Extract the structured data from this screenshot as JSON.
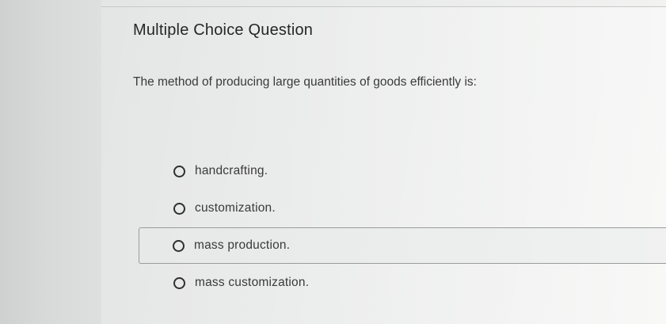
{
  "question": {
    "title": "Multiple Choice Question",
    "prompt": "The method of producing large quantities of goods efficiently is:"
  },
  "options": [
    {
      "label": "handcrafting."
    },
    {
      "label": "customization."
    },
    {
      "label": "mass production.",
      "highlighted": true
    },
    {
      "label": "mass customization."
    }
  ]
}
